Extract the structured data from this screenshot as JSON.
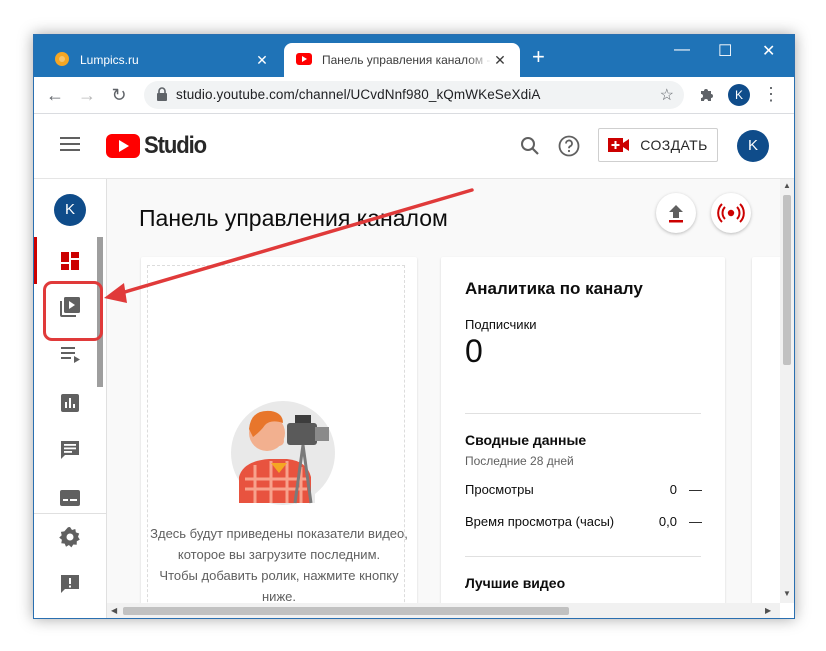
{
  "browser": {
    "tabs": [
      {
        "title": "Lumpics.ru",
        "active": false,
        "favicon": "orange-circle-icon"
      },
      {
        "title": "Панель управления каналом - ",
        "active": true,
        "favicon": "youtube-play-icon"
      }
    ],
    "new_tab_label": "+",
    "window_controls": {
      "minimize": "—",
      "maximize": "☐",
      "close": "✕"
    },
    "url": "studio.youtube.com/channel/UCvdNnf980_kQmWKeSeXdiA",
    "profile_initial": "K"
  },
  "header": {
    "logo_text": "Studio",
    "create_label": "СОЗДАТЬ",
    "avatar_initial": "K"
  },
  "rail": {
    "avatar_initial": "K",
    "items": [
      {
        "name": "dashboard-icon",
        "active": true
      },
      {
        "name": "videos-icon",
        "active": false
      },
      {
        "name": "playlists-icon",
        "active": false
      },
      {
        "name": "analytics-icon",
        "active": false
      },
      {
        "name": "comments-icon",
        "active": false
      },
      {
        "name": "subtitles-icon",
        "active": false
      },
      {
        "name": "settings-icon",
        "active": false
      },
      {
        "name": "feedback-icon",
        "active": false
      }
    ]
  },
  "main": {
    "page_title": "Панель управления каналом",
    "empty_card": {
      "lines": [
        "Здесь будут приведены показатели видео,",
        "которое вы загрузите последним.",
        "Чтобы добавить ролик, нажмите кнопку",
        "ниже."
      ]
    },
    "analytics": {
      "title": "Аналитика по каналу",
      "subscribers_label": "Подписчики",
      "subscribers_value": "0",
      "summary_title": "Сводные данные",
      "summary_period": "Последние 28 дней",
      "rows": [
        {
          "label": "Просмотры",
          "value": "0",
          "trend": "—"
        },
        {
          "label": "Время просмотра (часы)",
          "value": "0,0",
          "trend": "—"
        }
      ],
      "best_videos_title": "Лучшие видео"
    }
  },
  "colors": {
    "accent_red": "#cc0000",
    "annotation_red": "#e03a3a",
    "chrome_blue": "#1f73b7",
    "avatar_blue": "#0f4c8a"
  }
}
